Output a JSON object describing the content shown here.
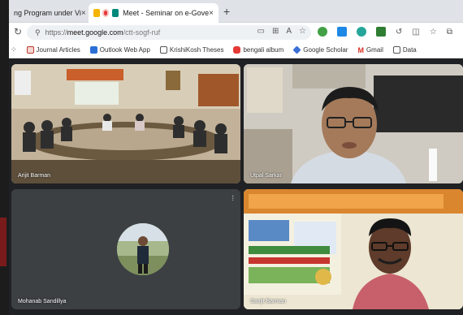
{
  "browser": {
    "tabs": [
      {
        "title": "ng Program under Vi",
        "active": false
      },
      {
        "title": "Meet - Seminar on e-Gove",
        "active": true
      }
    ],
    "close_glyph": "×",
    "new_tab_glyph": "+",
    "url": {
      "scheme": "https://",
      "domain": "meet.google.com",
      "path": "/ctt-sogf-ruf"
    },
    "bookmarks": [
      {
        "label": "Journal Articles",
        "icon": "folder-icon",
        "color": "#c0392b"
      },
      {
        "label": "Outlook Web App",
        "icon": "outlook-icon",
        "color": "#2b6fd6"
      },
      {
        "label": "KrishiKosh Theses",
        "icon": "document-icon",
        "color": "#555555"
      },
      {
        "label": "bengali album",
        "icon": "youtube-icon",
        "color": "#e53935"
      },
      {
        "label": "Google Scholar",
        "icon": "scholar-icon",
        "color": "#3b6fd6"
      },
      {
        "label": "Gmail",
        "icon": "gmail-icon",
        "color": "#d93025"
      },
      {
        "label": "Data",
        "icon": "document-icon",
        "color": "#555555"
      }
    ]
  },
  "meet": {
    "participants": [
      {
        "name": "Arijit Barman"
      },
      {
        "name": "Utpal Sarkar"
      },
      {
        "name": "Mohanab Sandillya",
        "avatar": true
      },
      {
        "name": "Sanjit Barman"
      }
    ]
  }
}
